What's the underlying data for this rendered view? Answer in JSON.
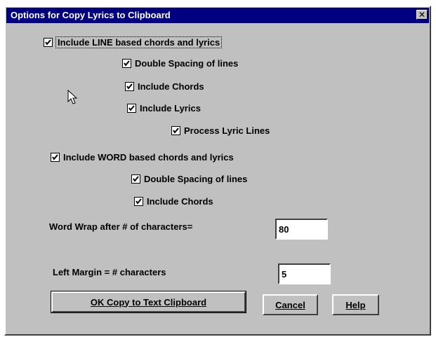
{
  "window": {
    "title": "Options for Copy Lyrics to Clipboard",
    "close_label": "✕"
  },
  "options": {
    "line_based": {
      "label": "Include LINE based chords and lyrics",
      "checked": true
    },
    "line_double_spacing": {
      "label": "Double Spacing of lines",
      "checked": true
    },
    "line_include_chords": {
      "label": "Include Chords",
      "checked": true
    },
    "line_include_lyrics": {
      "label": "Include Lyrics",
      "checked": true
    },
    "line_process_lyric_lines": {
      "label": "Process Lyric Lines",
      "checked": true
    },
    "word_based": {
      "label": "Include WORD based chords and lyrics",
      "checked": true
    },
    "word_double_spacing": {
      "label": "Double Spacing of lines",
      "checked": true
    },
    "word_include_chords": {
      "label": "Include Chords",
      "checked": true
    }
  },
  "word_wrap": {
    "label": "Word Wrap after # of characters=",
    "value": "80"
  },
  "left_margin": {
    "label": "Left Margin = # characters",
    "value": "5"
  },
  "buttons": {
    "ok": "OK Copy to Text Clipboard",
    "cancel": "Cancel",
    "help": "Help"
  }
}
